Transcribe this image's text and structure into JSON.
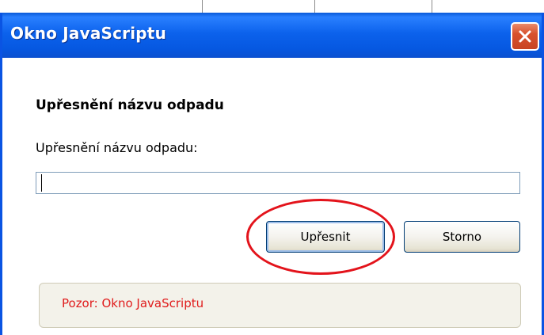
{
  "window": {
    "title": "Okno JavaScriptu"
  },
  "dialog": {
    "heading": "Upřesnění názvu odpadu",
    "label": "Upřesnění názvu odpadu:",
    "input_value": "",
    "confirm_label": "Upřesnit",
    "cancel_label": "Storno",
    "warning": "Pozor: Okno JavaScriptu"
  },
  "colors": {
    "titlebar": "#0c62ec",
    "close_button": "#d8512d",
    "highlight": "#e3131b",
    "warning_text": "#e01b1b"
  },
  "icons": {
    "close": "close-icon"
  }
}
